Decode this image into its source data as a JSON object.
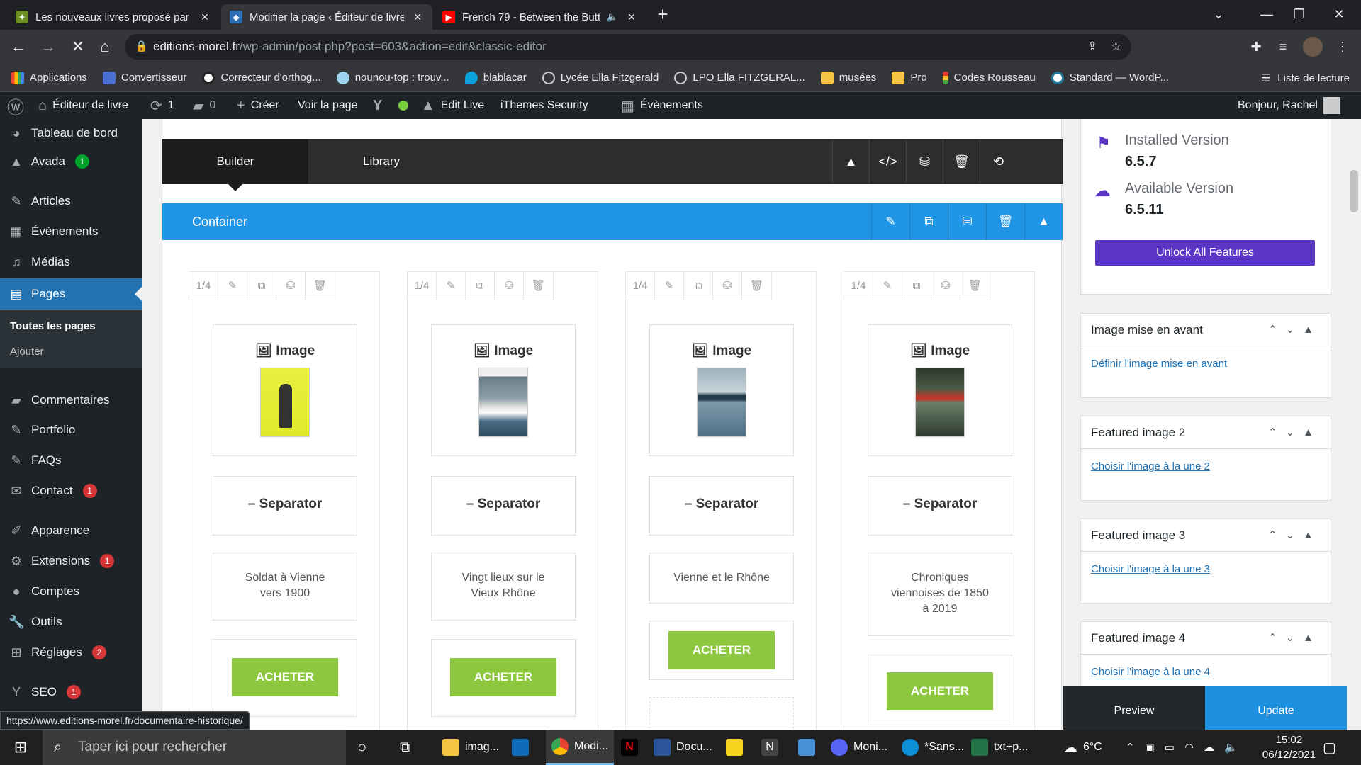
{
  "browser": {
    "tabs": [
      {
        "title": "Les nouveaux livres proposé par",
        "favicon": "yellow-leaf-icon",
        "color": "#d4a017"
      },
      {
        "title": "Modifier la page ‹ Éditeur de livre",
        "favicon": "avada-icon",
        "color": "#f5c518"
      },
      {
        "title": "French 79 - Between the Butt",
        "favicon": "youtube-icon",
        "color": "#ff0000"
      }
    ],
    "url_domain": "editions-morel.fr",
    "url_path": "/wp-admin/post.php?post=603&action=edit&classic-editor",
    "bookmarks": [
      "Applications",
      "Convertisseur",
      "Correcteur d'orthog...",
      "nounou-top : trouv...",
      "blablacar",
      "Lycée Ella Fitzgerald",
      "LPO Ella FITZGERAL...",
      "musées",
      "Pro",
      "Codes Rousseau",
      "Standard — WordP..."
    ],
    "reading_list": "Liste de lecture"
  },
  "adminbar": {
    "site": "Éditeur de livre",
    "updates": "1",
    "comments": "0",
    "create": "Créer",
    "view_page": "Voir la page",
    "edit_live": "Edit Live",
    "security": "iThemes Security",
    "events": "Évènements",
    "greeting": "Bonjour, Rachel"
  },
  "menu": {
    "dashboard": "Tableau de bord",
    "avada": "Avada",
    "avada_badge": "1",
    "articles": "Articles",
    "events": "Évènements",
    "media": "Médias",
    "pages": "Pages",
    "all_pages": "Toutes les pages",
    "add": "Ajouter",
    "comments": "Commentaires",
    "portfolio": "Portfolio",
    "faqs": "FAQs",
    "contact": "Contact",
    "contact_badge": "1",
    "appearance": "Apparence",
    "extensions": "Extensions",
    "extensions_badge": "1",
    "accounts": "Comptes",
    "tools": "Outils",
    "settings": "Réglages",
    "settings_badge": "2",
    "seo": "SEO",
    "seo_badge": "1"
  },
  "status_url": "https://www.editions-morel.fr/documentaire-historique/",
  "builder": {
    "tab_builder": "Builder",
    "tab_library": "Library",
    "container_label": "Container",
    "columns": [
      {
        "size": "1/4",
        "image_label": "Image",
        "separator_label": "Separator",
        "text_lines": [
          "Soldat à Vienne",
          "vers 1900"
        ],
        "button": "ACHETER"
      },
      {
        "size": "1/4",
        "image_label": "Image",
        "separator_label": "Separator",
        "text_lines": [
          "Vingt lieux sur le",
          "Vieux Rhône"
        ],
        "button": "ACHETER"
      },
      {
        "size": "1/4",
        "image_label": "Image",
        "separator_label": "Separator",
        "text_lines": [
          "Vienne et le Rhône"
        ],
        "button": "ACHETER"
      },
      {
        "size": "1/4",
        "image_label": "Image",
        "separator_label": "Separator",
        "text_lines": [
          "Chroniques",
          "viennoises de 1850",
          "à 2019"
        ],
        "button": "ACHETER"
      }
    ]
  },
  "sidebar": {
    "installed_label": "Installed Version",
    "installed_value": "6.5.7",
    "available_label": "Available Version",
    "available_value": "6.5.11",
    "unlock_button": "Unlock All Features",
    "boxes": [
      {
        "title": "Image mise en avant",
        "link": "Définir l'image mise en avant"
      },
      {
        "title": "Featured image 2",
        "link": "Choisir l'image à la une 2"
      },
      {
        "title": "Featured image 3",
        "link": "Choisir l'image à la une 3"
      },
      {
        "title": "Featured image 4",
        "link": "Choisir l'image à la une 4"
      }
    ],
    "preview": "Preview",
    "update": "Update"
  },
  "taskbar": {
    "search_placeholder": "Taper ici pour rechercher",
    "apps": [
      "imag...",
      "Modi...",
      "Docu...",
      "Moni...",
      "*Sans...",
      "txt+p..."
    ],
    "weather": "6°C",
    "time": "15:02",
    "date": "06/12/2021"
  },
  "colors": {
    "accent": "#2196e6",
    "button_green": "#8dc63f",
    "wp_dark": "#1d2327",
    "unlock_purple": "#5b35c4",
    "update_blue": "#1e90e0"
  }
}
